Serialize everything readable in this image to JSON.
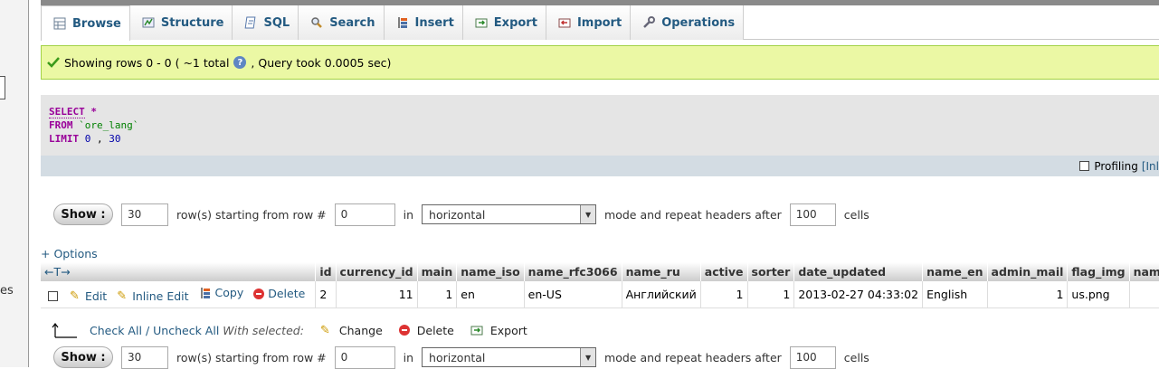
{
  "left_nav": {
    "cut_text": "es"
  },
  "tabs": [
    {
      "id": "browse",
      "label": "Browse",
      "icon": "table-icon",
      "active": true
    },
    {
      "id": "structure",
      "label": "Structure",
      "icon": "structure-icon"
    },
    {
      "id": "sql",
      "label": "SQL",
      "icon": "sql-icon"
    },
    {
      "id": "search",
      "label": "Search",
      "icon": "search-icon"
    },
    {
      "id": "insert",
      "label": "Insert",
      "icon": "insert-icon"
    },
    {
      "id": "export",
      "label": "Export",
      "icon": "export-icon"
    },
    {
      "id": "import",
      "label": "Import",
      "icon": "import-icon"
    },
    {
      "id": "operations",
      "label": "Operations",
      "icon": "wrench-icon"
    }
  ],
  "message": {
    "prefix": "Showing rows 0 - 0 ( ~1 total",
    "suffix": ", Query took 0.0005 sec)"
  },
  "sql": {
    "select": "SELECT",
    "star": "*",
    "from": "FROM",
    "table": "`ore_lang`",
    "limit": "LIMIT",
    "limit_start": "0",
    "limit_sep": ",",
    "limit_count": "30"
  },
  "profiling": {
    "label": "Profiling",
    "inline_link": "[Inl"
  },
  "navigation": {
    "show_label": "Show :",
    "rows": "30",
    "rows_text": "row(s) starting from row #",
    "start": "0",
    "in_text": "in",
    "mode": "horizontal",
    "mode_text": "mode and repeat headers after",
    "repeat": "100",
    "cells_text": "cells"
  },
  "options_link": "+ Options",
  "table": {
    "sort_arrows": "←T→",
    "columns": [
      "id",
      "currency_id",
      "main",
      "name_iso",
      "name_rfc3066",
      "name_ru",
      "active",
      "sorter",
      "date_updated",
      "name_en",
      "admin_mail",
      "flag_img",
      "name_de"
    ],
    "actions": {
      "edit": "Edit",
      "inline_edit": "Inline Edit",
      "copy": "Copy",
      "delete": "Delete"
    },
    "rows": [
      [
        "2",
        "11",
        "1",
        "en",
        "en-US",
        "Английский",
        "1",
        "1",
        "2013-02-27 04:33:02",
        "English",
        "1",
        "us.png",
        ""
      ]
    ]
  },
  "bulk": {
    "check_all": "Check All",
    "separator": "/",
    "uncheck_all": "Uncheck All",
    "with_selected": "With selected:",
    "change": "Change",
    "delete": "Delete",
    "export": "Export"
  },
  "colors": {
    "link": "#235a81",
    "success_bg": "#ebf8a4",
    "keyword": "#990099"
  }
}
